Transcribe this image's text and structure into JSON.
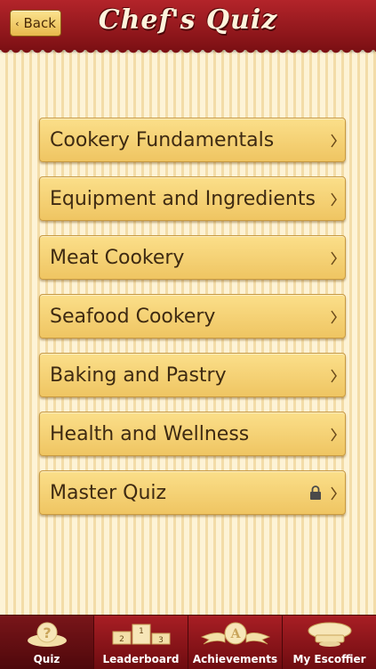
{
  "header": {
    "back_label": "Back",
    "title": "Chef's Quiz"
  },
  "menu": {
    "items": [
      {
        "label": "Cookery Fundamentals",
        "locked": false
      },
      {
        "label": "Equipment and Ingredients",
        "locked": false
      },
      {
        "label": "Meat Cookery",
        "locked": false
      },
      {
        "label": "Seafood Cookery",
        "locked": false
      },
      {
        "label": "Baking and Pastry",
        "locked": false
      },
      {
        "label": "Health and Wellness",
        "locked": false
      },
      {
        "label": "Master Quiz",
        "locked": true
      }
    ]
  },
  "tabbar": {
    "tabs": [
      {
        "label": "Quiz",
        "icon": "question-icon",
        "active": true
      },
      {
        "label": "Leaderboard",
        "icon": "podium-icon",
        "active": false
      },
      {
        "label": "Achievements",
        "icon": "award-icon",
        "active": false
      },
      {
        "label": "My Escoffier",
        "icon": "chef-hat-icon",
        "active": false
      }
    ]
  },
  "colors": {
    "header_red": "#9a1a1f",
    "button_gold": "#f5d272",
    "text_brown": "#3e2a12"
  }
}
